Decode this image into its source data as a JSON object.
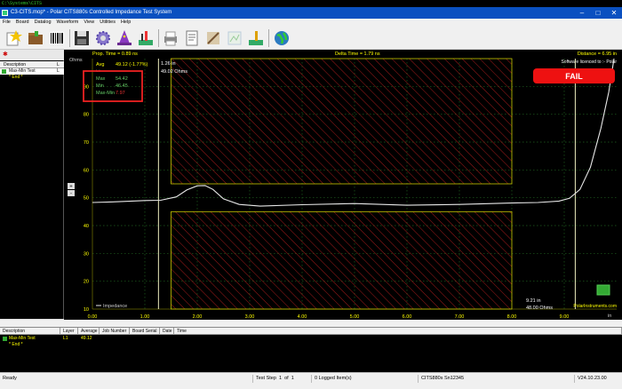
{
  "topstrip": "C:\\Systems\\CITS",
  "window": {
    "title": "C3-CITS.mop* - Polar CITS880s Controlled Impedance Test System"
  },
  "menu": [
    "File",
    "Board",
    "Datalog",
    "Waveform",
    "View",
    "Utilities",
    "Help"
  ],
  "toolbar_icons": [
    "new-board-icon",
    "open-folder-icon",
    "barcode-icon",
    "save-icon",
    "settings-gear-icon",
    "wizard-hat-icon",
    "probe-test-icon",
    "print-icon",
    "report-icon",
    "erase-icon",
    "disabled-map-icon",
    "calibrate-icon",
    "globe-icon"
  ],
  "left_panel": {
    "headers": [
      "Description",
      "L"
    ],
    "rows": [
      {
        "label": "Max-Min Test",
        "layer": "L",
        "selected": true
      },
      {
        "label": "* End *",
        "layer": "",
        "selected": false
      }
    ]
  },
  "graph": {
    "prop_time": "Prop. Time = 0.89 ns",
    "delta_time": "Delta Time = 1.79 ns",
    "distance": "Distance = 6.95 in",
    "licensed": "Software licenced to :- Polar",
    "y_unit": "Ohms",
    "x_unit": "in",
    "avg_label": "Avg",
    "avg_value": "49.12 (-1.77%)",
    "hidden_row_label": "Lo",
    "max_label": "Max",
    "max_value": "54.42",
    "min_label": "Min",
    "min_value": "46.45",
    "maxmin_label": "Max-Min",
    "maxmin_value": "7.97",
    "cursor1_pos": "1.26 in",
    "cursor1_val": "49.02 Ohms",
    "cursor2_pos": "9.21 in",
    "cursor2_val": "48.00 Ohms",
    "fail_label": "FAIL",
    "legend": "Impedance",
    "brand": "PolarInstruments.com",
    "colors": {
      "fail": "#ee1111",
      "grid": "#1f5f1f",
      "trace": "#e8e8e8",
      "limit": "#c8c800",
      "hatch": "#cc2222"
    }
  },
  "chart_data": {
    "type": "line",
    "title": "",
    "xlabel": "in",
    "ylabel": "Ohms",
    "xlim": [
      0,
      10
    ],
    "ylim": [
      10,
      100
    ],
    "x_ticks": [
      "0.00",
      "1.00",
      "2.00",
      "3.00",
      "4.00",
      "5.00",
      "6.00",
      "7.00",
      "8.00",
      "9.00"
    ],
    "y_ticks": [
      "10",
      "20",
      "30",
      "40",
      "50",
      "60",
      "70",
      "80",
      "90"
    ],
    "grid": true,
    "limit_bands": [
      {
        "x": [
          1.5,
          8.0
        ],
        "y": [
          55,
          100
        ]
      },
      {
        "x": [
          1.5,
          8.0
        ],
        "y": [
          10,
          45
        ]
      }
    ],
    "cursors_x": [
      1.26,
      9.21
    ],
    "series": [
      {
        "name": "Impedance",
        "x": [
          0,
          0.5,
          1.0,
          1.3,
          1.6,
          1.8,
          2.0,
          2.15,
          2.3,
          2.5,
          2.8,
          3.2,
          4.0,
          5.0,
          6.0,
          7.0,
          8.0,
          8.5,
          8.9,
          9.1,
          9.3,
          9.5,
          9.7,
          9.85,
          9.95
        ],
        "values": [
          48.3,
          48.6,
          49.0,
          49.1,
          50.3,
          52.8,
          54.3,
          54.4,
          53.0,
          49.6,
          47.6,
          47.0,
          47.5,
          47.9,
          47.3,
          47.6,
          48.1,
          48.3,
          48.8,
          49.8,
          53.0,
          61.0,
          75.0,
          88.0,
          100.0
        ]
      }
    ]
  },
  "table": {
    "headers": [
      "Description",
      "Layer",
      "Average",
      "Job Number",
      "Board Serial",
      "Date",
      "Time"
    ],
    "rows": [
      {
        "description": "Max-Min Test",
        "layer": "L1",
        "average": "49.12"
      },
      {
        "description": "* End *",
        "layer": "",
        "average": ""
      }
    ]
  },
  "status": {
    "ready": "Ready",
    "test_step": "Test Step",
    "step_num": "1",
    "of_text": "of",
    "step_total": "1",
    "logged": "0 Logged Item(s)",
    "serial": "CITS880s Sn12345",
    "version": "V24.10.23.00"
  }
}
